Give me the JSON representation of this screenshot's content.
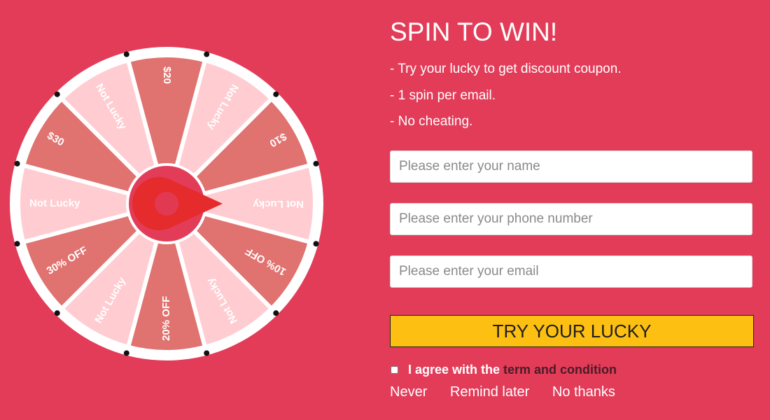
{
  "wheel": {
    "slices": [
      {
        "label": "$20",
        "color": "#e0726f"
      },
      {
        "label": "Not Lucky",
        "color": "#ffccd1"
      },
      {
        "label": "$10",
        "color": "#e0726f"
      },
      {
        "label": "Not Lucky",
        "color": "#ffccd1"
      },
      {
        "label": "10% OFF",
        "color": "#e0726f"
      },
      {
        "label": "Not Lucky",
        "color": "#ffccd1"
      },
      {
        "label": "20% OFF",
        "color": "#e0726f"
      },
      {
        "label": "Not Lucky",
        "color": "#ffccd1"
      },
      {
        "label": "30% OFF",
        "color": "#e0726f"
      },
      {
        "label": "Not Lucky",
        "color": "#ffccd1"
      },
      {
        "label": "$30",
        "color": "#e0726f"
      },
      {
        "label": "Not Lucky",
        "color": "#ffccd1"
      }
    ],
    "rim_color": "#ffffff",
    "hub_color": "#e23c59",
    "pointer_color": "#e52b2b",
    "pointer_icon": "pointer-icon"
  },
  "panel": {
    "title": "SPIN TO WIN!",
    "rules": [
      "- Try your lucky to get discount coupon.",
      "- 1 spin per email.",
      "- No cheating."
    ],
    "name_placeholder": "Please enter your name",
    "phone_placeholder": "Please enter your phone number",
    "email_placeholder": "Please enter your email",
    "submit_label": "TRY YOUR LUCKY",
    "submit_color": "#fdbf11",
    "agree_text": "I agree with the",
    "term_link": "term and condition",
    "footer_links": [
      "Never",
      "Remind later",
      "No thanks"
    ]
  }
}
